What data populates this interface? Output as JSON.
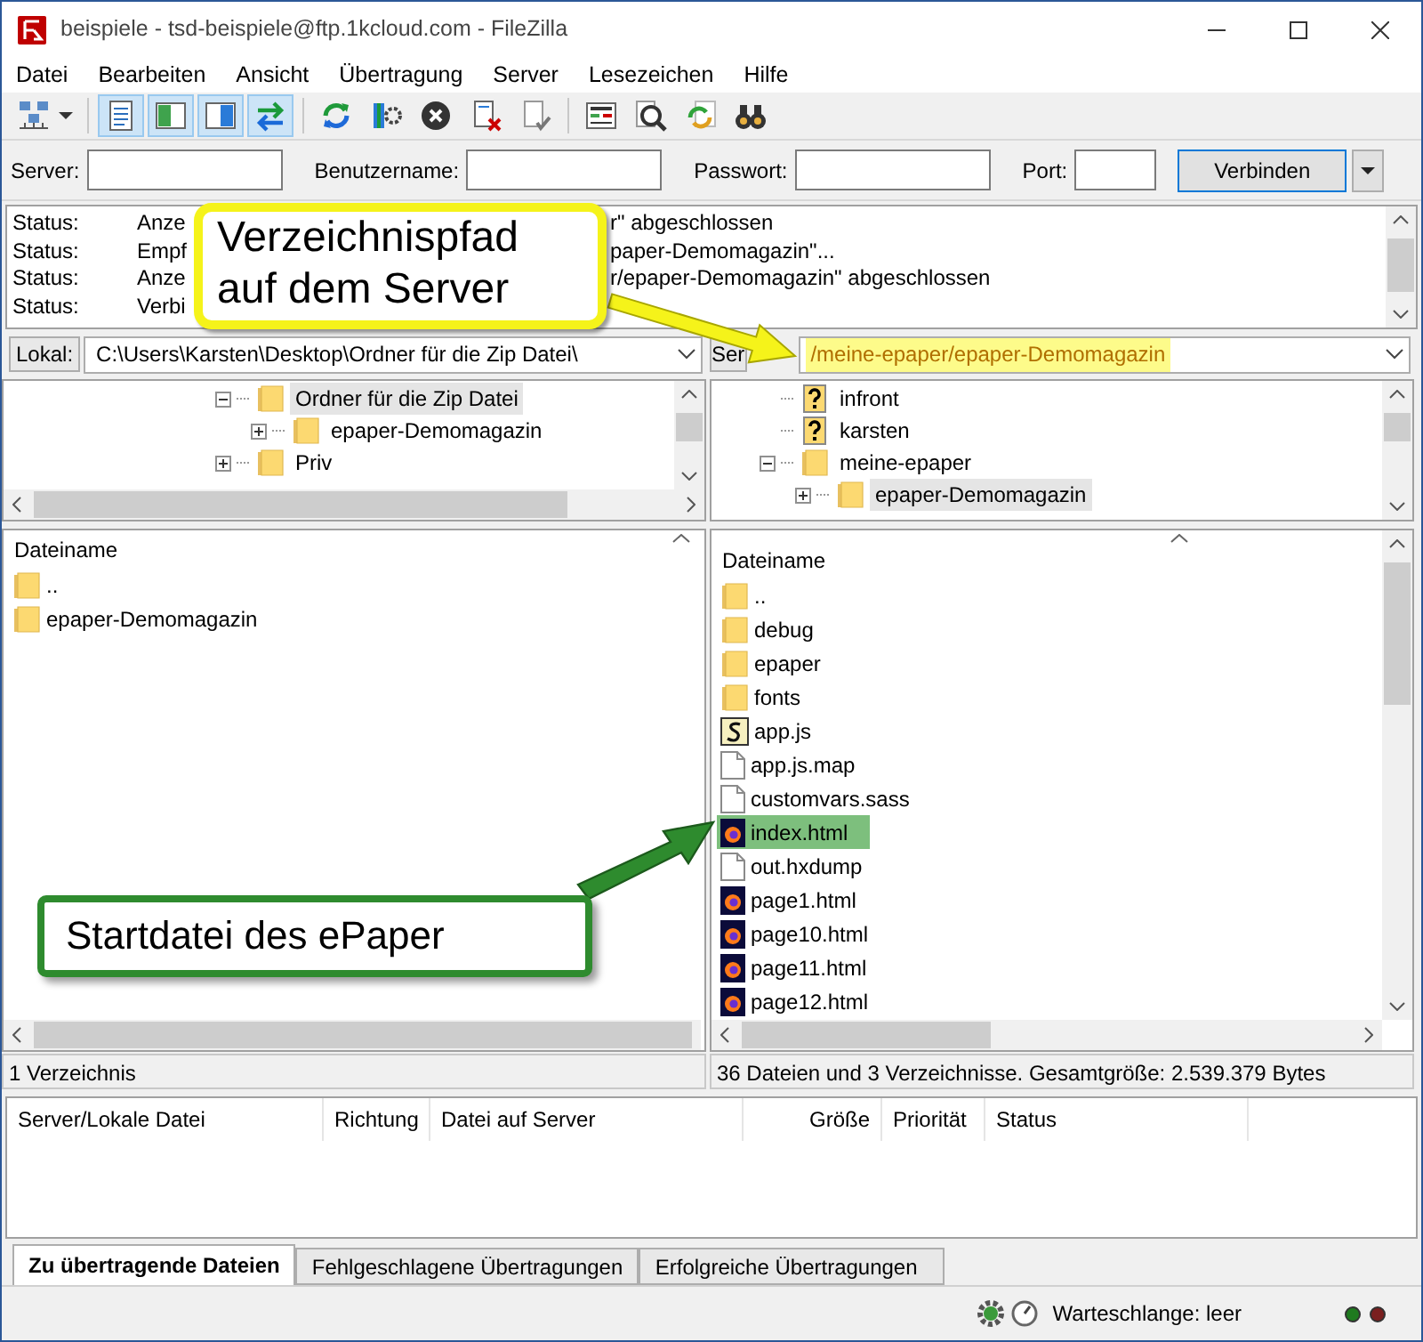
{
  "window": {
    "title": "beispiele - tsd-beispiele@ftp.1kcloud.com - FileZilla"
  },
  "menu": [
    "Datei",
    "Bearbeiten",
    "Ansicht",
    "Übertragung",
    "Server",
    "Lesezeichen",
    "Hilfe"
  ],
  "toolbar": [
    {
      "kind": "sitemanager"
    },
    {
      "kind": "separator"
    },
    {
      "kind": "log",
      "pressed": true
    },
    {
      "kind": "localtree",
      "pressed": true
    },
    {
      "kind": "remotetree",
      "pressed": true
    },
    {
      "kind": "queue",
      "pressed": true
    },
    {
      "kind": "separator"
    },
    {
      "kind": "refresh"
    },
    {
      "kind": "filters"
    },
    {
      "kind": "cancel"
    },
    {
      "kind": "disconnect"
    },
    {
      "kind": "reconnect"
    },
    {
      "kind": "separator"
    },
    {
      "kind": "compare"
    },
    {
      "kind": "find"
    },
    {
      "kind": "sync"
    },
    {
      "kind": "binoculars"
    }
  ],
  "quickconnect": {
    "fields": [
      {
        "label": "Server:"
      },
      {
        "label": "Benutzername:"
      },
      {
        "label": "Passwort:"
      },
      {
        "label": "Port:"
      }
    ],
    "button": "Verbinden"
  },
  "log": [
    {
      "label": "Status:",
      "start": "Anze",
      "end": "r\" abgeschlossen"
    },
    {
      "label": "Status:",
      "start": "Empf",
      "end": "paper-Demomagazin\"..."
    },
    {
      "label": "Status:",
      "start": "Anze",
      "end": "r/epaper-Demomagazin\" abgeschlossen"
    },
    {
      "label": "Status:",
      "start": "Verbi"
    }
  ],
  "local": {
    "path_label": "Lokal:",
    "path": "C:\\Users\\Karsten\\Desktop\\Ordner für die Zip Datei\\",
    "tree": [
      {
        "name": "Ordner für die Zip Datei",
        "kind": "folder",
        "expanded": true,
        "selected": true,
        "children": [
          {
            "name": "epaper-Demomagazin",
            "kind": "folder",
            "expanded": false,
            "selected": false
          }
        ]
      },
      {
        "name": "Priv",
        "kind": "folder",
        "expanded": false,
        "selected": false
      }
    ],
    "column": "Dateiname",
    "files": [
      {
        "name": "..",
        "kind": "folder",
        "highlighted": false
      },
      {
        "name": "epaper-Demomagazin",
        "kind": "folder",
        "highlighted": false
      }
    ],
    "status": "1 Verzeichnis"
  },
  "remote": {
    "path_label": "Ser",
    "path": "/meine-epaper/epaper-Demomagazin",
    "path_highlighted": true,
    "tree": [
      {
        "name": "infront",
        "kind": "unknown",
        "selected": false
      },
      {
        "name": "karsten",
        "kind": "unknown",
        "selected": false
      },
      {
        "name": "meine-epaper",
        "kind": "folder",
        "expanded": true,
        "selected": false,
        "children": [
          {
            "name": "epaper-Demomagazin",
            "kind": "folder",
            "expanded": false,
            "selected": true
          }
        ]
      }
    ],
    "column": "Dateiname",
    "files": [
      {
        "name": "..",
        "kind": "folder",
        "highlighted": false
      },
      {
        "name": "debug",
        "kind": "folder",
        "highlighted": false
      },
      {
        "name": "epaper",
        "kind": "folder",
        "highlighted": false
      },
      {
        "name": "fonts",
        "kind": "folder",
        "highlighted": false
      },
      {
        "name": "app.js",
        "kind": "script",
        "highlighted": false
      },
      {
        "name": "app.js.map",
        "kind": "file",
        "highlighted": false
      },
      {
        "name": "customvars.sass",
        "kind": "file",
        "highlighted": false
      },
      {
        "name": "index.html",
        "kind": "html",
        "highlighted": true
      },
      {
        "name": "out.hxdump",
        "kind": "file",
        "highlighted": false
      },
      {
        "name": "page1.html",
        "kind": "html",
        "highlighted": false
      },
      {
        "name": "page10.html",
        "kind": "html",
        "highlighted": false
      },
      {
        "name": "page11.html",
        "kind": "html",
        "highlighted": false
      },
      {
        "name": "page12.html",
        "kind": "html",
        "highlighted": false
      }
    ],
    "status": "36 Dateien und 3 Verzeichnisse. Gesamtgröße: 2.539.379 Bytes"
  },
  "queue": {
    "columns": [
      "Server/Lokale Datei",
      "Richtung",
      "Datei auf Server",
      "Größe",
      "Priorität",
      "Status"
    ]
  },
  "tabs": [
    {
      "label": "Zu übertragende Dateien",
      "selected": true
    },
    {
      "label": "Fehlgeschlagene Übertragungen",
      "selected": false
    },
    {
      "label": "Erfolgreiche Übertragungen",
      "selected": false
    }
  ],
  "status_bar": {
    "queue": "Warteschlange: leer",
    "lights": [
      {
        "color": "#1f7a1f"
      },
      {
        "color": "#7a1f1f"
      }
    ]
  },
  "callouts": [
    {
      "kind": "yellow",
      "text": "Verzeichnispfad auf dem Server"
    },
    {
      "kind": "green",
      "text": "Startdatei des ePaper"
    }
  ]
}
